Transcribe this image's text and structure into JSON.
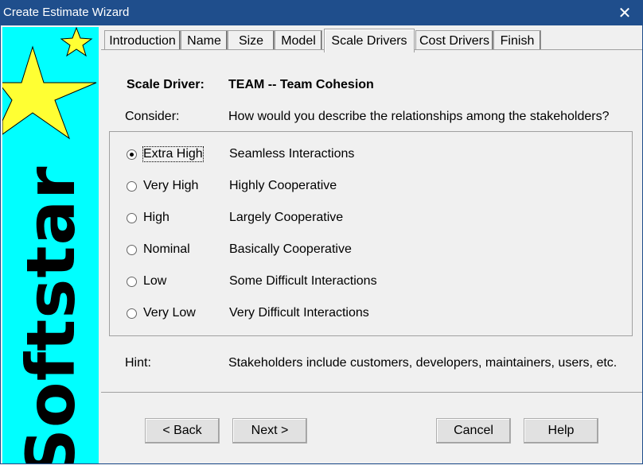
{
  "window": {
    "title": "Create Estimate Wizard"
  },
  "banner": {
    "brand": "Softstar"
  },
  "tabs": [
    {
      "label": "Introduction"
    },
    {
      "label": "Name"
    },
    {
      "label": "Size"
    },
    {
      "label": "Model"
    },
    {
      "label": "Scale Drivers",
      "active": true
    },
    {
      "label": "Cost Drivers"
    },
    {
      "label": "Finish"
    }
  ],
  "driver": {
    "label": "Scale Driver:",
    "name": "TEAM -- Team Cohesion",
    "consider_label": "Consider:",
    "question": "How would you describe the relationships among the stakeholders?"
  },
  "options": [
    {
      "rating": "Extra High",
      "description": "Seamless Interactions",
      "selected": true
    },
    {
      "rating": "Very High",
      "description": "Highly Cooperative",
      "selected": false
    },
    {
      "rating": "High",
      "description": "Largely Cooperative",
      "selected": false
    },
    {
      "rating": "Nominal",
      "description": "Basically Cooperative",
      "selected": false
    },
    {
      "rating": "Low",
      "description": "Some Difficult Interactions",
      "selected": false
    },
    {
      "rating": "Very Low",
      "description": "Very Difficult Interactions",
      "selected": false
    }
  ],
  "hint": {
    "label": "Hint:",
    "text": "Stakeholders include customers, developers, maintainers, users, etc."
  },
  "buttons": {
    "back": "< Back",
    "next": "Next >",
    "cancel": "Cancel",
    "help": "Help"
  },
  "colors": {
    "titlebar": "#1f4e8c",
    "banner": "#00ffff",
    "star": "#ffff33"
  }
}
